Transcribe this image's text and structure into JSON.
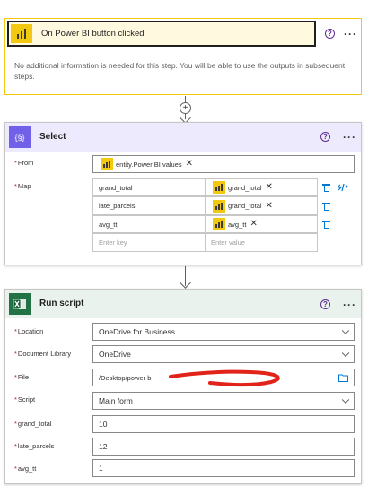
{
  "trigger": {
    "title": "On Power BI button clicked",
    "help_icon": "?",
    "more_icon": "···",
    "info": "No additional information is needed for this step. You will be able to use the outputs in subsequent steps.",
    "accent": "#f2c811",
    "icon": "power-bi-icon"
  },
  "add_step_icon": "+",
  "select": {
    "title": "Select",
    "icon_glyph": "{§}",
    "accent": "#7160e8",
    "help_icon": "?",
    "more_icon": "···",
    "from_label": "From",
    "from_token": "entity.Power BI values",
    "map_label": "Map",
    "map_rows": [
      {
        "key": "grand_total",
        "value": "grand_total"
      },
      {
        "key": "late_parcels",
        "value": "grand_total"
      },
      {
        "key": "avg_tt",
        "value": "avg_tt"
      }
    ],
    "key_placeholder": "Enter key",
    "value_placeholder": "Enter value"
  },
  "run_script": {
    "title": "Run script",
    "accent": "#217346",
    "help_icon": "?",
    "more_icon": "···",
    "fields": {
      "location_label": "Location",
      "location_value": "OneDrive for Business",
      "doclib_label": "Document Library",
      "doclib_value": "OneDrive",
      "file_label": "File",
      "file_value": "/Desktop/power b",
      "script_label": "Script",
      "script_value": "Main form",
      "grand_total_label": "grand_total",
      "grand_total_value": "10",
      "late_parcels_label": "late_parcels",
      "late_parcels_value": "12",
      "avg_tt_label": "avg_tt",
      "avg_tt_value": "1"
    }
  }
}
